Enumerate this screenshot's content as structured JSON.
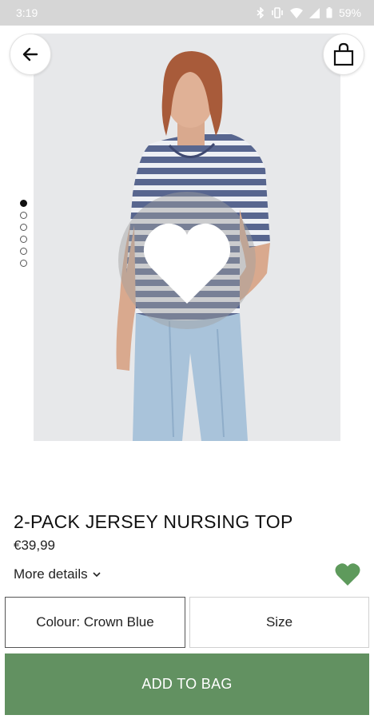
{
  "status_bar": {
    "time": "3:19",
    "battery": "59%",
    "icons": [
      "bluetooth-icon",
      "vibrate-icon",
      "wifi-icon",
      "signal-icon",
      "battery-icon"
    ]
  },
  "header": {
    "back_icon": "arrow-left-icon",
    "bag_icon": "shopping-bag-icon"
  },
  "gallery": {
    "image_count": 6,
    "active_index": 0,
    "overlay_icon": "heart-icon"
  },
  "product": {
    "title": "2-PACK JERSEY NURSING TOP",
    "price": "€39,99",
    "more_details": "More details",
    "wishlist_icon": "heart-icon",
    "wishlist_color": "#5e9a5c"
  },
  "options": {
    "colour_label": "Colour: Crown Blue",
    "size_label": "Size"
  },
  "cta": {
    "add_to_bag": "ADD TO BAG",
    "color": "#629161"
  }
}
